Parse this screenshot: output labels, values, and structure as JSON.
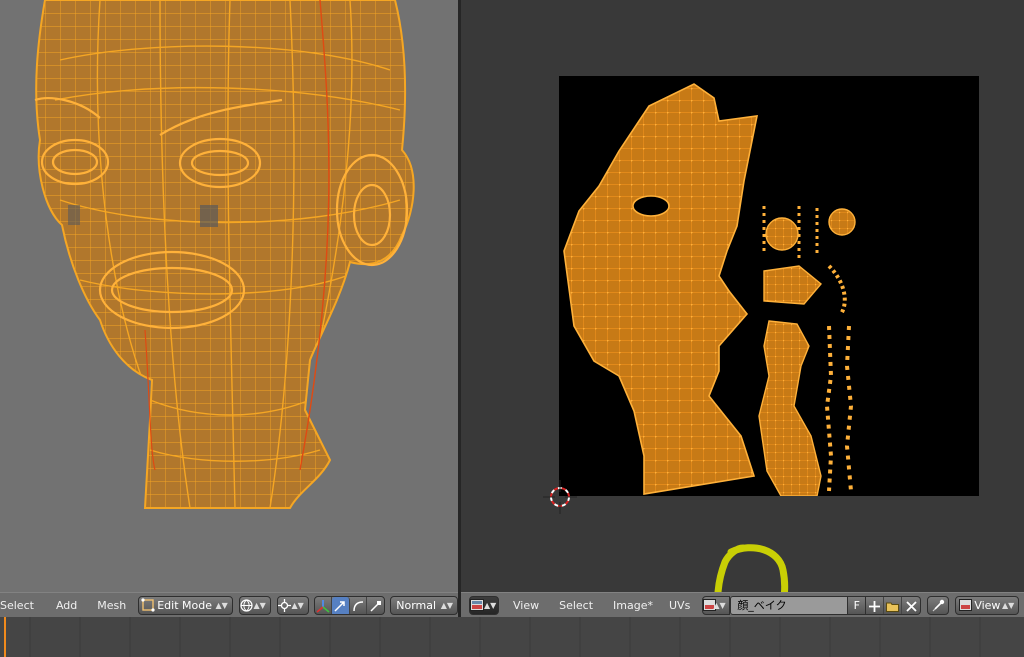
{
  "left_header": {
    "menus": [
      "Select",
      "Add",
      "Mesh"
    ],
    "mode": "Edit Mode",
    "orientation": "Normal"
  },
  "right_header": {
    "menus": [
      "View",
      "Select",
      "Image*",
      "UVs"
    ],
    "image_name": "顔_ベイク",
    "fake_user": "F",
    "view_label": "View"
  },
  "colors": {
    "mesh": "#f5a623",
    "mesh_fill": "#c77a16",
    "viewport_bg": "#727272",
    "uv_bg": "#000000",
    "header_bg": "#6d6d6d",
    "active": "#5680c2",
    "highlight": "#d9e000"
  },
  "icons": [
    "editmode-icon",
    "shading-sphere-icon",
    "pivot-icon",
    "manipulator-axes-icon",
    "translate-icon",
    "rotate-icon",
    "scale-icon",
    "editor-type-icon",
    "image-browse-icon",
    "new-image-icon",
    "open-image-icon",
    "unlink-icon",
    "pin-icon",
    "view-mode-icon"
  ]
}
